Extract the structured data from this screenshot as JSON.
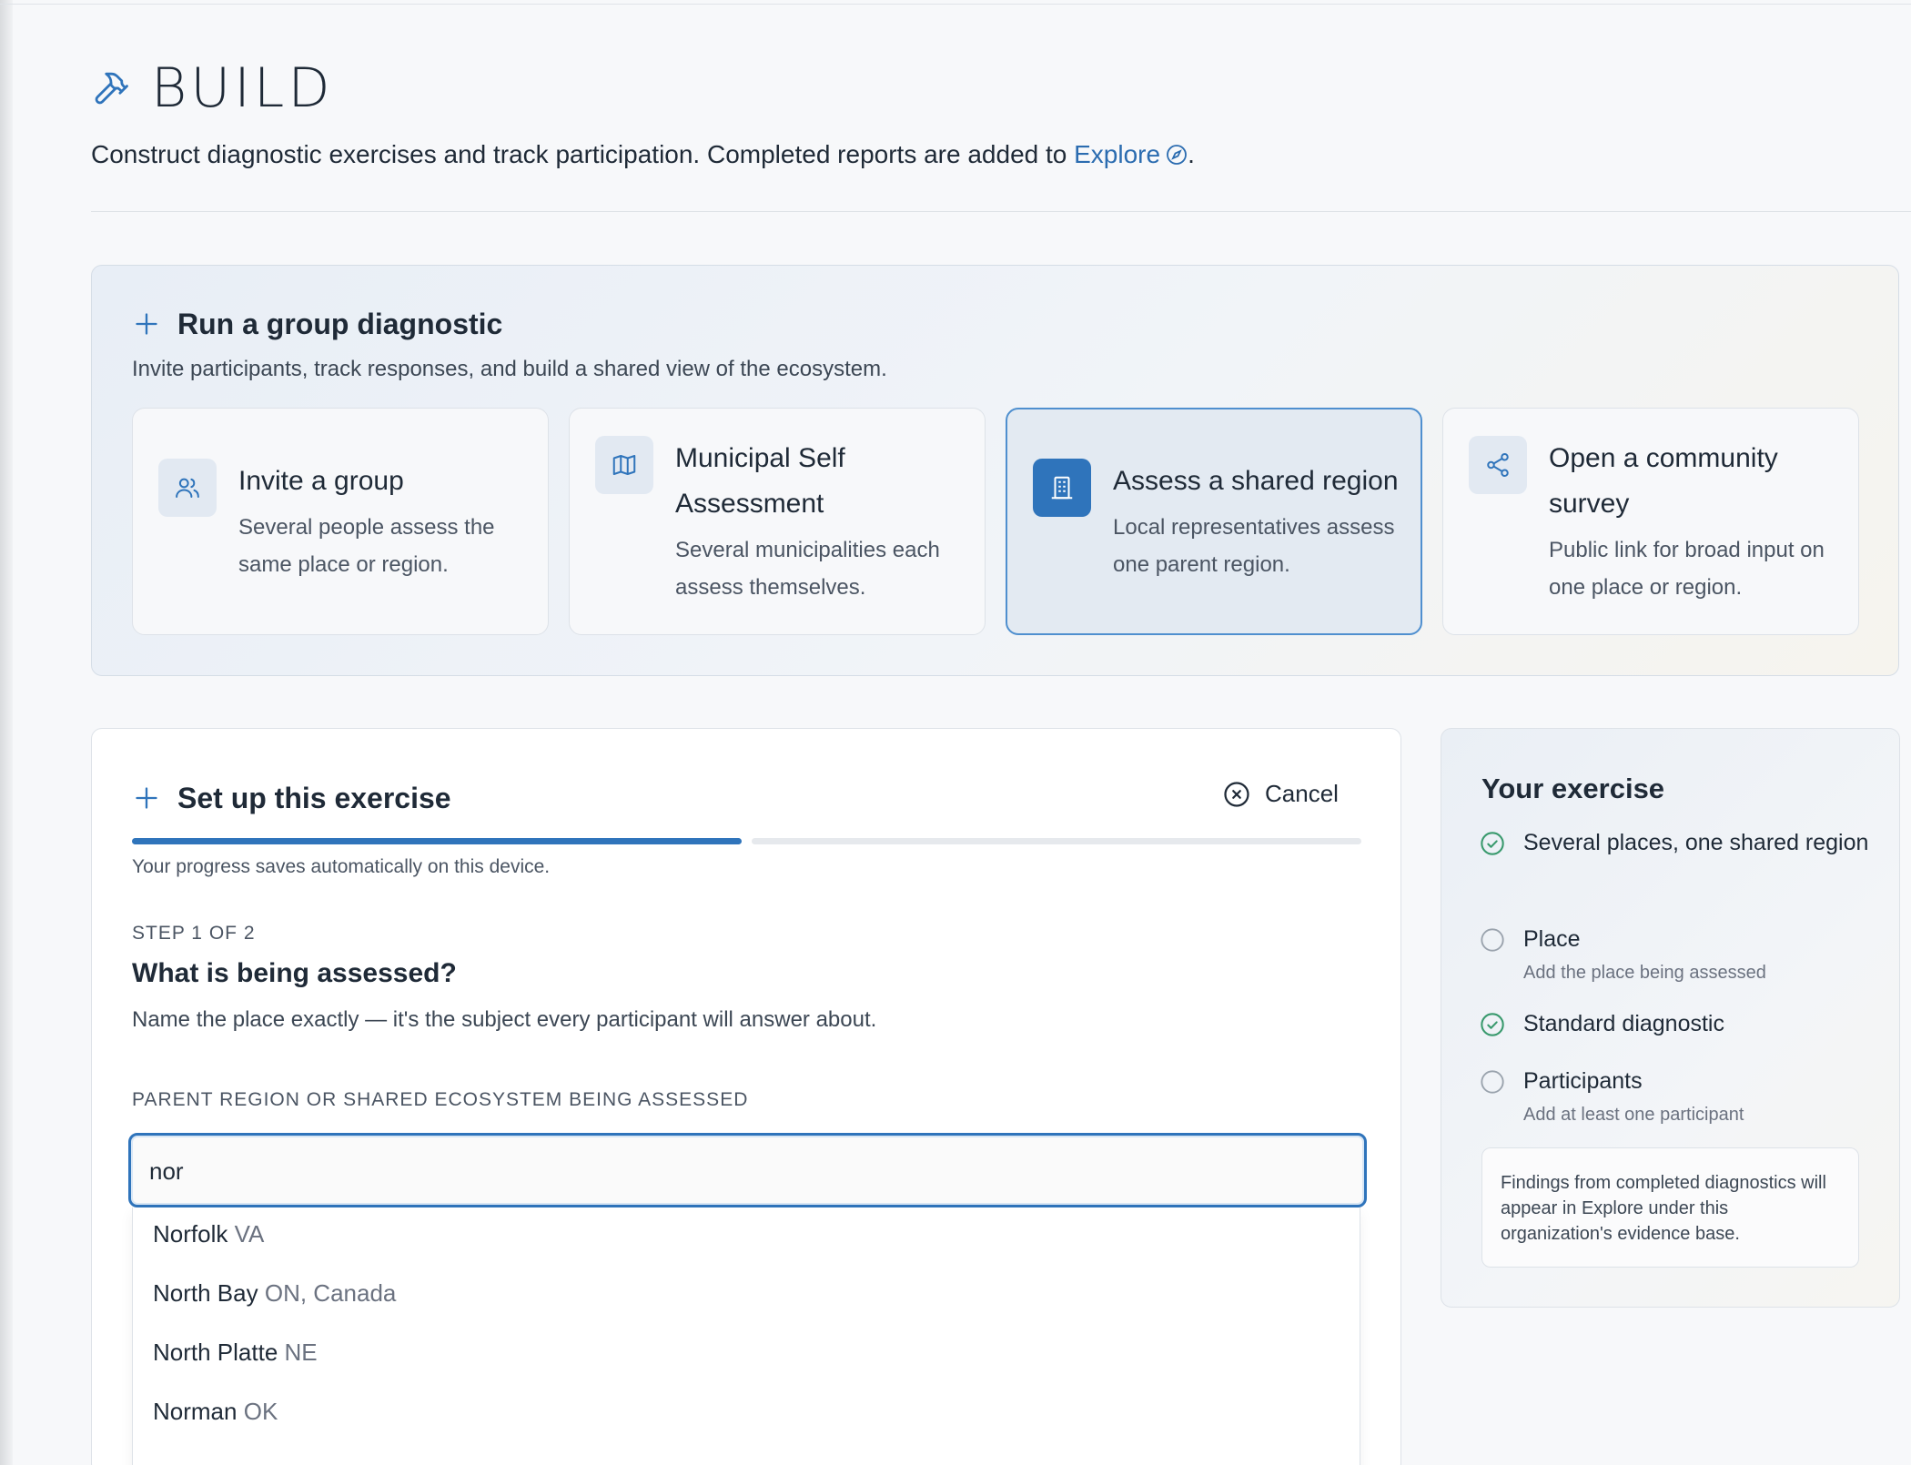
{
  "header": {
    "title": "BUILD",
    "subtitle_prefix": "Construct diagnostic exercises and track participation. Completed reports are added to ",
    "explore_link": "Explore",
    "subtitle_suffix": "."
  },
  "group": {
    "title": "Run a group diagnostic",
    "subtitle": "Invite participants, track responses, and build a shared view of the ecosystem.",
    "cards": [
      {
        "title": "Invite a group",
        "desc": "Several people assess the same place or region.",
        "icon": "users-icon",
        "selected": false
      },
      {
        "title": "Municipal Self Assessment",
        "desc": "Several municipalities each assess themselves.",
        "icon": "map-icon",
        "selected": false
      },
      {
        "title": "Assess a shared region",
        "desc": "Local representatives assess one parent region.",
        "icon": "building-icon",
        "selected": true
      },
      {
        "title": "Open a community survey",
        "desc": "Public link for broad input on one place or region.",
        "icon": "share-icon",
        "selected": false
      }
    ]
  },
  "setup": {
    "title": "Set up this exercise",
    "cancel_label": "Cancel",
    "progress_note": "Your progress saves automatically on this device.",
    "progress": {
      "current_step": 1,
      "total_steps": 2
    },
    "step_label": "STEP 1 OF 2",
    "question": "What is being assessed?",
    "hint": "Name the place exactly — it's the subject every participant will answer about.",
    "field_label": "PARENT REGION OR SHARED ECOSYSTEM BEING ASSESSED",
    "field_value": "nor",
    "suggestions": [
      {
        "name": "Norfolk",
        "region": "VA"
      },
      {
        "name": "North Bay",
        "region": "ON, Canada"
      },
      {
        "name": "North Platte",
        "region": "NE"
      },
      {
        "name": "Norman",
        "region": "OK"
      }
    ]
  },
  "summary": {
    "title": "Your exercise",
    "items": [
      {
        "label": "Several places, one shared region",
        "sub": "",
        "done": true
      },
      {
        "label": "Place",
        "sub": "Add the place being assessed",
        "done": false
      },
      {
        "label": "Standard diagnostic",
        "sub": "",
        "done": true
      },
      {
        "label": "Participants",
        "sub": "Add at least one participant",
        "done": false
      }
    ],
    "note": "Findings from completed diagnostics will appear in Explore under this organization's evidence base."
  },
  "colors": {
    "accent": "#2f74bb",
    "done_check": "#3a9a6e",
    "pending": "#9aa3ad"
  }
}
